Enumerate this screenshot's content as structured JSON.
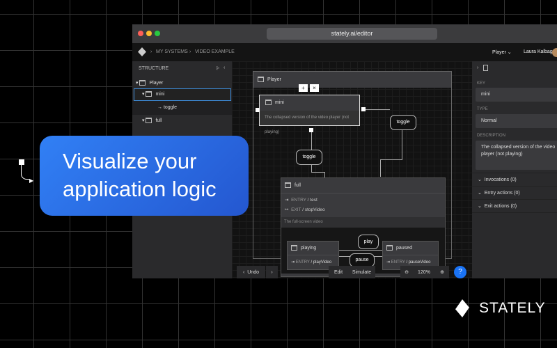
{
  "browser": {
    "url": "stately.ai/editor"
  },
  "header": {
    "breadcrumb": [
      "MY SYSTEMS",
      "VIDEO EXAMPLE"
    ],
    "machine_select": "Player",
    "user": "Laura Kalbag"
  },
  "sidebar": {
    "title": "STRUCTURE",
    "items": [
      {
        "label": "Player"
      },
      {
        "label": "mini"
      },
      {
        "label": "toggle"
      },
      {
        "label": "full"
      }
    ]
  },
  "canvas": {
    "player": "Player",
    "mini": {
      "title": "mini",
      "description": "The collapsed version of the video player (not playing)"
    },
    "events": {
      "toggle1": "toggle",
      "toggle2": "toggle",
      "play": "play",
      "pause": "pause"
    },
    "full": {
      "title": "full",
      "entry_kw": "ENTRY",
      "entry": "test",
      "exit_kw": "EXIT",
      "exit": "stopVideo",
      "description": "The full-screen video"
    },
    "playing": {
      "title": "playing",
      "entry_kw": "ENTRY",
      "entry": "playVideo"
    },
    "paused": {
      "title": "paused",
      "entry_kw": "ENTRY",
      "entry": "pauseVideo"
    },
    "add": "+",
    "remove": "×"
  },
  "toolbar": {
    "undo": "Undo",
    "edit": "Edit",
    "simulate": "Simulate",
    "zoom": "120%",
    "help": "?"
  },
  "panel": {
    "key_label": "KEY",
    "key": "mini",
    "type_label": "TYPE",
    "type": "Normal",
    "desc_label": "DESCRIPTION",
    "description": "The collapsed version of the video player (not playing)",
    "sections": [
      "Invocations (0)",
      "Entry actions (0)",
      "Exit actions (0)"
    ]
  },
  "callout": {
    "text": "Visualize your application logic"
  },
  "brand": {
    "name": "STATELY"
  },
  "colors": {
    "accent": "#2d6ff0",
    "help": "#1a73f5"
  }
}
